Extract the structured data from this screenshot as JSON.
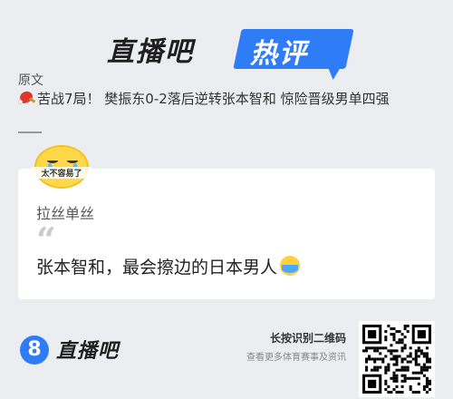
{
  "header": {
    "brand_title": "直播吧",
    "hot_label": "热评"
  },
  "original": {
    "label": "原文",
    "icon": "ping-pong-icon",
    "text": "苦战7局！ 樊振东0-2落后逆转张本智和 惊险晋级男单四强"
  },
  "comment": {
    "avatar_sticker_text": "太不容易了",
    "username": "拉丝单丝",
    "text": "张本智和，最会擦边的日本男人",
    "trailing_icon": "crying-face-icon"
  },
  "footer": {
    "logo_mark": "8",
    "logo_text": "直播吧",
    "qr_label": "长按识别二维码",
    "qr_sub": "查看更多体育赛事及资讯"
  },
  "colors": {
    "accent": "#2f7df6",
    "background": "#ecedf1",
    "card": "#ffffff"
  }
}
